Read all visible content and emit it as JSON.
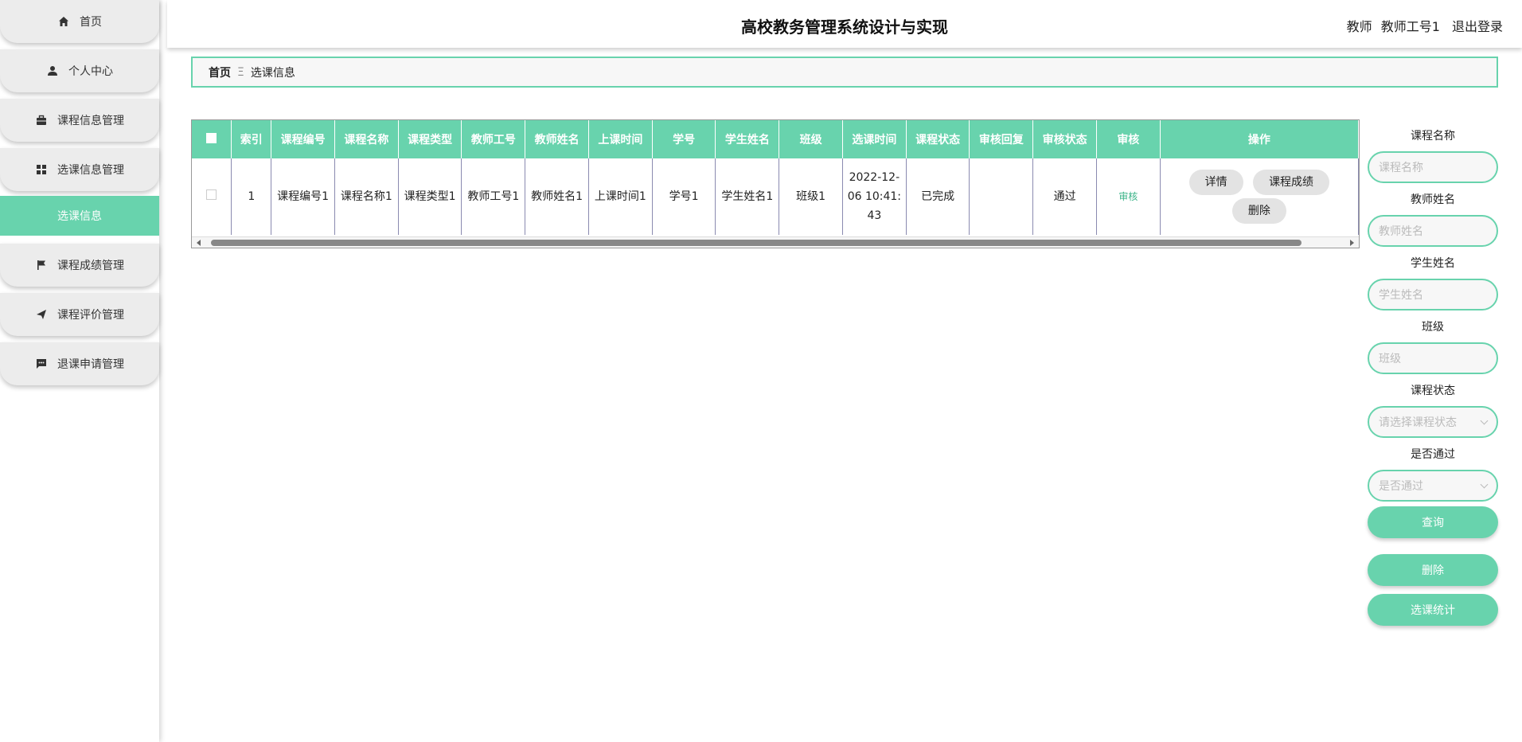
{
  "app": {
    "title": "高校教务管理系统设计与实现",
    "user_role": "教师",
    "user_name": "教师工号1",
    "logout": "退出登录"
  },
  "sidebar": {
    "items": [
      {
        "label": "首页",
        "icon": "home-icon"
      },
      {
        "label": "个人中心",
        "icon": "person-icon"
      },
      {
        "label": "课程信息管理",
        "icon": "briefcase-icon"
      },
      {
        "label": "选课信息管理",
        "icon": "grid-icon"
      },
      {
        "label": "选课信息",
        "icon": "",
        "active": true
      },
      {
        "label": "课程成绩管理",
        "icon": "flag-icon"
      },
      {
        "label": "课程评价管理",
        "icon": "send-icon"
      },
      {
        "label": "退课申请管理",
        "icon": "chat-icon"
      }
    ],
    "accent": "#68d3ad"
  },
  "breadcrumb": {
    "home": "首页",
    "separator": "Ξ",
    "current": "选课信息"
  },
  "table": {
    "headers": [
      "索引",
      "课程编号",
      "课程名称",
      "课程类型",
      "教师工号",
      "教师姓名",
      "上课时间",
      "学号",
      "学生姓名",
      "班级",
      "选课时间",
      "课程状态",
      "审核回复",
      "审核状态",
      "审核",
      "操作"
    ],
    "row": {
      "index": "1",
      "course_no": "课程编号1",
      "course_name": "课程名称1",
      "course_type": "课程类型1",
      "teacher_no": "教师工号1",
      "teacher_name": "教师姓名1",
      "class_time": "上课时间1",
      "student_no": "学号1",
      "student_name": "学生姓名1",
      "class": "班级1",
      "select_time": "2022-12-06 10:41:43",
      "course_status": "已完成",
      "audit_reply": "",
      "audit_status": "通过",
      "audit_link": "审核",
      "actions": [
        "详情",
        "课程成绩",
        "删除"
      ]
    }
  },
  "search": {
    "course_name_label": "课程名称",
    "course_name_placeholder": "课程名称",
    "teacher_name_label": "教师姓名",
    "teacher_name_placeholder": "教师姓名",
    "student_name_label": "学生姓名",
    "student_name_placeholder": "学生姓名",
    "class_label": "班级",
    "class_placeholder": "班级",
    "status_label": "课程状态",
    "status_placeholder": "请选择课程状态",
    "pass_label": "是否通过",
    "pass_placeholder": "是否通过",
    "query_button": "查询",
    "delete_button": "删除",
    "stats_button": "选课统计"
  }
}
